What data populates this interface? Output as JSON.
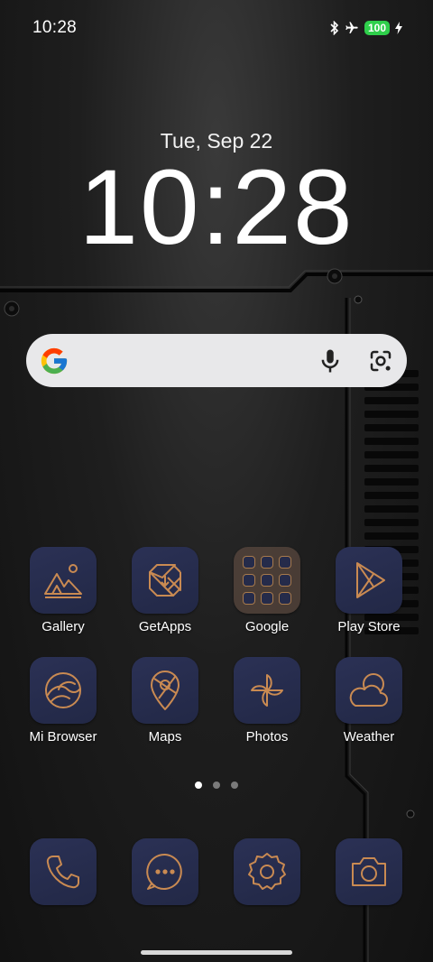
{
  "status": {
    "time": "10:28",
    "battery": "100",
    "icons": [
      "bluetooth-icon",
      "airplane-icon",
      "charging-icon"
    ]
  },
  "widget": {
    "date": "Tue, Sep 22",
    "clock": "10:28"
  },
  "search": {
    "icons": [
      "google-logo",
      "mic-icon",
      "lens-icon"
    ]
  },
  "apps": {
    "row1": [
      {
        "label": "Gallery",
        "icon": "gallery-icon"
      },
      {
        "label": "GetApps",
        "icon": "getapps-icon"
      },
      {
        "label": "Google",
        "icon": "google-folder"
      },
      {
        "label": "Play Store",
        "icon": "play-store-icon"
      }
    ],
    "row2": [
      {
        "label": "Mi Browser",
        "icon": "browser-icon"
      },
      {
        "label": "Maps",
        "icon": "maps-icon"
      },
      {
        "label": "Photos",
        "icon": "photos-icon"
      },
      {
        "label": "Weather",
        "icon": "weather-icon"
      }
    ]
  },
  "dock": [
    {
      "icon": "phone-icon"
    },
    {
      "icon": "messages-icon"
    },
    {
      "icon": "settings-icon"
    },
    {
      "icon": "camera-icon"
    }
  ],
  "pager": {
    "pages": 3,
    "active": 1
  },
  "colors": {
    "icon_stroke": "#c98a52",
    "tile_bg": "#262c4c",
    "search_bg": "#e8e8ea"
  }
}
